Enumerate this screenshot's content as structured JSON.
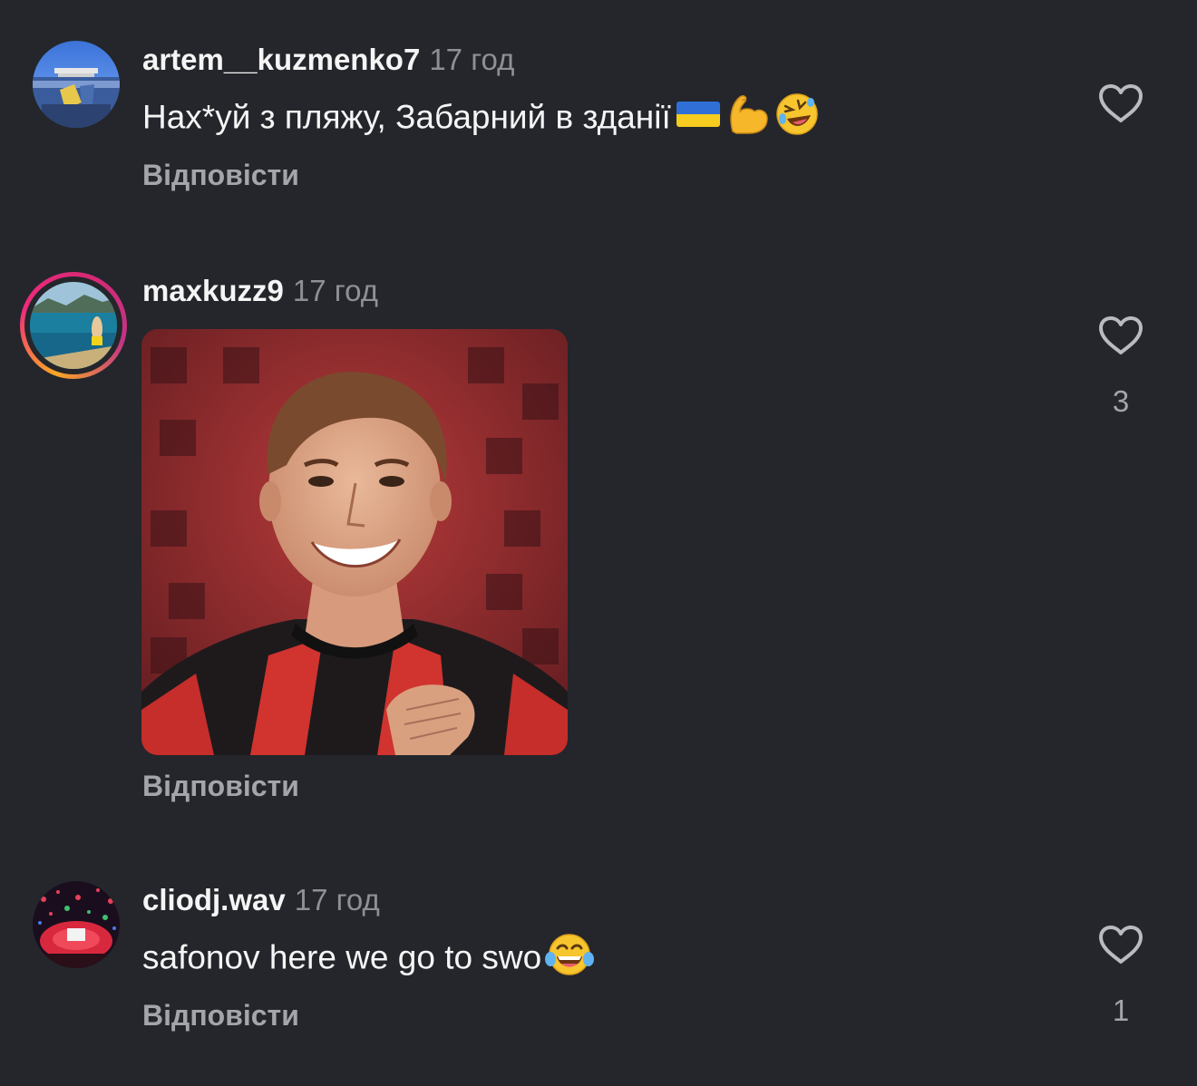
{
  "comments": [
    {
      "username": "artem__kuzmenko7",
      "time": "17 год",
      "text": "Нах*уй з пляжу, Забарний в здані",
      "text_tail": "ї",
      "emojis": [
        "flag-ukraine-icon",
        "flexed-biceps-icon",
        "rolling-laughing-icon"
      ],
      "reply_label": "Відповісти",
      "likes": ""
    },
    {
      "username": "maxkuzz9",
      "time": "17 год",
      "has_story": true,
      "attachment": "photo of smiling young man in red and black striped football jersey",
      "reply_label": "Відповісти",
      "likes": "3"
    },
    {
      "username": "cliodj.wav",
      "time": "17 год",
      "text": "safonov here we go to swo",
      "emojis": [
        "tears-of-joy-icon"
      ],
      "reply_label": "Відповісти",
      "likes": "1"
    }
  ],
  "colors": {
    "background": "#24262b",
    "text": "#f5f5f5",
    "muted": "#8e9096",
    "reply": "#a3a5ab"
  }
}
